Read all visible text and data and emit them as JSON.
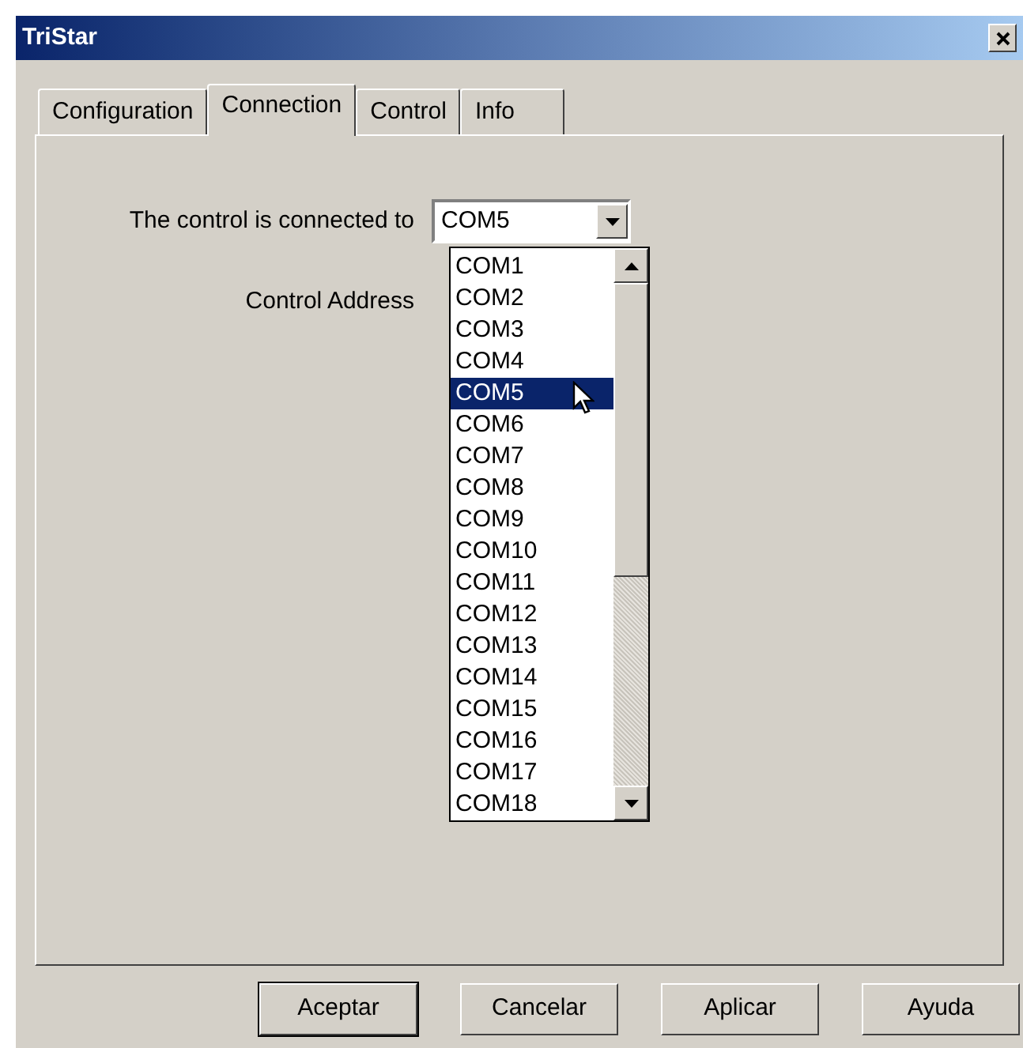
{
  "window": {
    "title": "TriStar"
  },
  "tabs": [
    {
      "label": "Configuration",
      "selected": false
    },
    {
      "label": "Connection",
      "selected": true
    },
    {
      "label": "Control",
      "selected": false
    },
    {
      "label": "Info",
      "selected": false
    }
  ],
  "connection": {
    "label": "The control is connected to",
    "value": "COM5",
    "expanded": true
  },
  "address": {
    "label": "Control Address"
  },
  "options": [
    {
      "label": "COM1",
      "selected": false
    },
    {
      "label": "COM2",
      "selected": false
    },
    {
      "label": "COM3",
      "selected": false
    },
    {
      "label": "COM4",
      "selected": false
    },
    {
      "label": "COM5",
      "selected": true
    },
    {
      "label": "COM6",
      "selected": false
    },
    {
      "label": "COM7",
      "selected": false
    },
    {
      "label": "COM8",
      "selected": false
    },
    {
      "label": "COM9",
      "selected": false
    },
    {
      "label": "COM10",
      "selected": false
    },
    {
      "label": "COM11",
      "selected": false
    },
    {
      "label": "COM12",
      "selected": false
    },
    {
      "label": "COM13",
      "selected": false
    },
    {
      "label": "COM14",
      "selected": false
    },
    {
      "label": "COM15",
      "selected": false
    },
    {
      "label": "COM16",
      "selected": false
    },
    {
      "label": "COM17",
      "selected": false
    },
    {
      "label": "COM18",
      "selected": false
    }
  ],
  "buttons": [
    {
      "label": "Aceptar",
      "default": true
    },
    {
      "label": "Cancelar",
      "default": false
    },
    {
      "label": "Aplicar",
      "default": false
    },
    {
      "label": "Ayuda",
      "default": false
    }
  ]
}
